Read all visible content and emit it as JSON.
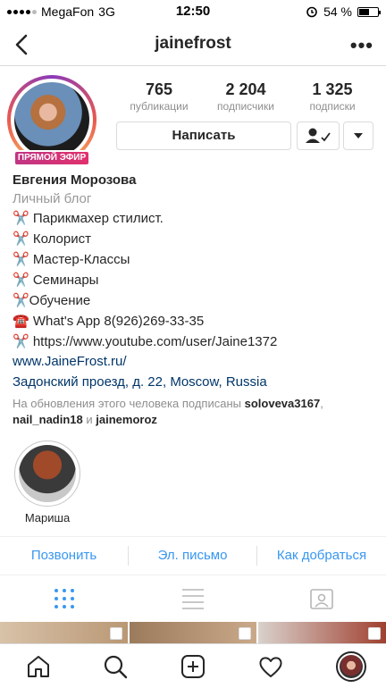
{
  "status_bar": {
    "carrier": "MegaFon",
    "network": "3G",
    "time": "12:50",
    "battery_text": "54 %",
    "battery_level": 0.54
  },
  "nav": {
    "username": "jainefrost",
    "back_icon": "chevron-left-icon",
    "more_icon": "more-dots-icon"
  },
  "profile": {
    "live_badge": "ПРЯМОЙ ЭФИР",
    "stats": [
      {
        "value": "765",
        "label": "публикации"
      },
      {
        "value": "2 204",
        "label": "подписчики"
      },
      {
        "value": "1 325",
        "label": "подписки"
      }
    ],
    "message_button": "Написать",
    "following_icon": "person-check-icon",
    "dropdown_icon": "caret-down-icon"
  },
  "bio": {
    "name": "Евгения Морозова",
    "category": "Личный блог",
    "lines": [
      "✂️ Парикмахер стилист.",
      "✂️ Колорист",
      "✂️ Мастер-Классы",
      "✂️ Семинары",
      "✂️Обучение",
      "☎️ What's App 8(926)269-33-35",
      "✂️ https://www.youtube.com/user/Jaine1372"
    ],
    "website": "www.JaineFrost.ru/",
    "address": "Задонский проезд, д. 22, Moscow, Russia",
    "followed_prefix": "На обновления этого человека подписаны",
    "followed_user_1": "soloveva3167",
    "followed_sep": ",",
    "followed_user_2": "nail_nadin18",
    "followed_and": "и",
    "followed_user_3": "jainemoroz"
  },
  "highlights": [
    {
      "label": "Мариша"
    }
  ],
  "actions": [
    "Позвонить",
    "Эл. письмо",
    "Как добраться"
  ],
  "colors": {
    "link_blue": "#3897f0",
    "link_dark": "#003569",
    "live_pink": "#e1306c"
  }
}
